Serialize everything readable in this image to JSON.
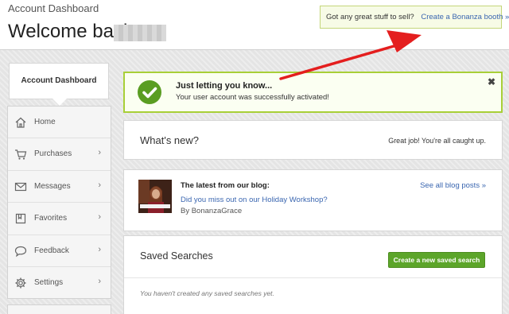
{
  "header": {
    "breadcrumb": "Account Dashboard",
    "welcome": "Welcome back,"
  },
  "sell_prompt": {
    "question": "Got any great stuff to sell?",
    "link": "Create a Bonanza booth »"
  },
  "sidebar": {
    "active_tab": "Account Dashboard",
    "items": [
      {
        "label": "Home",
        "icon": "home-icon",
        "has_chevron": false
      },
      {
        "label": "Purchases",
        "icon": "cart-icon",
        "has_chevron": true
      },
      {
        "label": "Messages",
        "icon": "envelope-icon",
        "has_chevron": true
      },
      {
        "label": "Favorites",
        "icon": "bookmark-icon",
        "has_chevron": true
      },
      {
        "label": "Feedback",
        "icon": "speech-bubble-icon",
        "has_chevron": true
      },
      {
        "label": "Settings",
        "icon": "gear-icon",
        "has_chevron": true
      }
    ],
    "chevron": "›"
  },
  "notice": {
    "title": "Just letting you know...",
    "text": "Your user account was successfully activated!",
    "close": "✖"
  },
  "whats_new": {
    "title": "What's new?",
    "status": "Great job! You're all caught up."
  },
  "blog": {
    "heading": "The latest from our blog:",
    "post_link": "Did you miss out on our Holiday Workshop?",
    "author": "By BonanzaGrace",
    "see_all": "See all blog posts »"
  },
  "saved_searches": {
    "title": "Saved Searches",
    "button": "Create a new saved search",
    "empty": "You haven't created any saved searches yet."
  },
  "colors": {
    "accent_green": "#5ca52a",
    "notice_border": "#a8cf38",
    "link_blue": "#3a66b0",
    "arrow_red": "#e41e1e"
  }
}
